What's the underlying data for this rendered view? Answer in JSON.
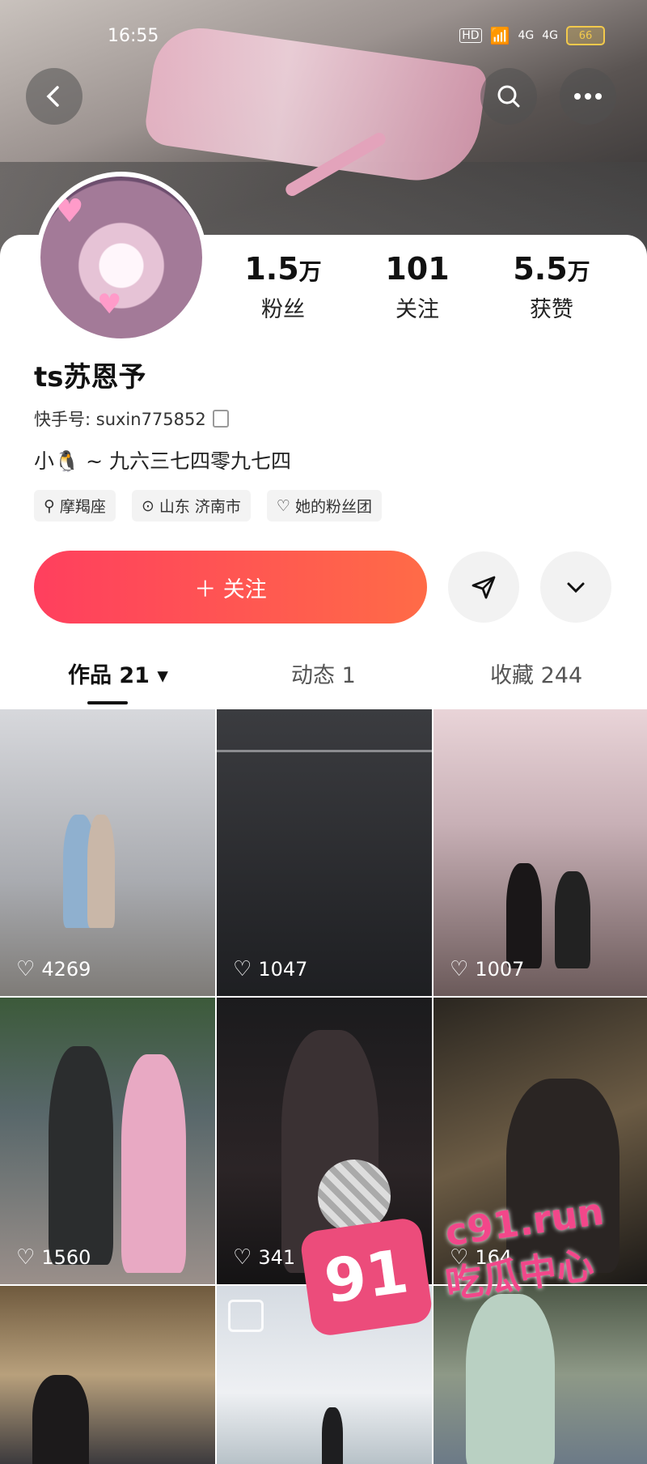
{
  "status_bar": {
    "time": "16:55",
    "hd": "HD",
    "net1": "4G",
    "net2": "4G",
    "battery": "66"
  },
  "header": {
    "back_icon": "chevron-left-icon",
    "search_icon": "search-icon",
    "more_icon": "more-dots-icon"
  },
  "profile": {
    "stats": [
      {
        "num": "1.5",
        "unit": "万",
        "label": "粉丝"
      },
      {
        "num": "101",
        "unit": "",
        "label": "关注"
      },
      {
        "num": "5.5",
        "unit": "万",
        "label": "获赞"
      }
    ],
    "name": "ts苏恩予",
    "kuaishou_id_label": "快手号: suxin775852",
    "bio": "小🐧 ~ 九六三七四零九七四",
    "tags": [
      "摩羯座",
      "山东 济南市",
      "她的粉丝团"
    ]
  },
  "actions": {
    "follow_label": "＋ 关注"
  },
  "tabs": [
    {
      "label": "作品 21 ▾"
    },
    {
      "label": "动态 1"
    },
    {
      "label": "收藏 244"
    }
  ],
  "posts": [
    {
      "likes": "4269"
    },
    {
      "likes": "1047"
    },
    {
      "likes": "1007"
    },
    {
      "likes": "1560"
    },
    {
      "likes": "341"
    },
    {
      "likes": "164"
    },
    {
      "likes": ""
    },
    {
      "likes": ""
    },
    {
      "likes": ""
    }
  ],
  "watermark": {
    "number": "91",
    "domain": "c91.run",
    "slogan": "吃瓜中心"
  }
}
